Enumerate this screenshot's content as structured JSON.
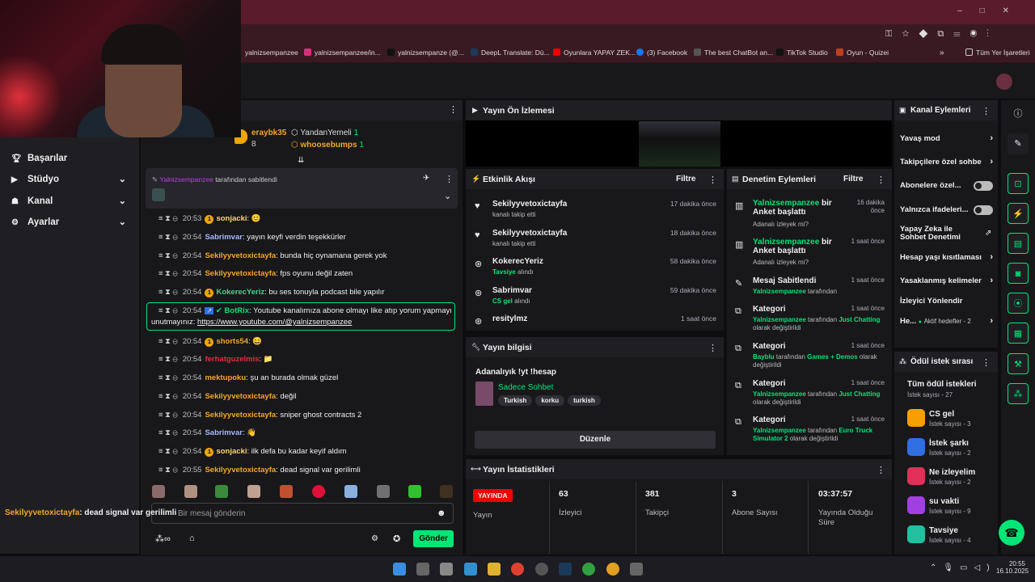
{
  "bookmarks": [
    "yalnizsempanzee",
    "yalnizsempanzee/in...",
    "yalnizsempanze (@...",
    "DeepL Translate: Dü...",
    "Oyunlara YAPAY ZEK...",
    "(3) Facebook",
    "The best ChatBot an...",
    "TikTok Studio",
    "Oyun - Quizei",
    "Tüm Yer İşaretleri"
  ],
  "nav": {
    "items": [
      "Başarılar",
      "Stüdyo",
      "Kanal",
      "Ayarlar"
    ]
  },
  "chat": {
    "top_users": [
      {
        "name": "eraybk35",
        "count": "8"
      },
      {
        "name": "YandanYemeli",
        "count": "1"
      },
      {
        "name": "whoosebumps",
        "count": "1"
      }
    ],
    "pinned_by": "Yalnizsempanzee",
    "pinned_suffix": "tarafından sabitlendi",
    "messages": [
      {
        "time": "20:53",
        "user": "sonjacki",
        "text": "😊",
        "color": "#ffd37a",
        "badge": "1"
      },
      {
        "time": "20:54",
        "user": "Sabrimvar",
        "text": "yayın keyfi verdin teşekkürler",
        "color": "#a6b8ff"
      },
      {
        "time": "20:54",
        "user": "Sekilyyvetoxictayfa",
        "text": "bunda hiç oynamana gerek yok",
        "color": "#f5a623"
      },
      {
        "time": "20:54",
        "user": "Sekilyyvetoxictayfa",
        "text": "fps oyunu değil zaten",
        "color": "#f5a623"
      },
      {
        "time": "20:54",
        "user": "KokerecYeriz",
        "text": "bu ses tonuyla podcast bile yapılır",
        "color": "#4ecf8c",
        "badge": "1"
      },
      {
        "time": "20:54",
        "user": "shorts54",
        "text": "😄",
        "color": "#f5a623",
        "badge": "1"
      },
      {
        "time": "20:54",
        "user": "ferhatguzelmis",
        "text": "📁",
        "color": "#e0303a"
      },
      {
        "time": "20:54",
        "user": "mektupoku",
        "text": "şu an burada olmak güzel",
        "color": "#f5a623"
      },
      {
        "time": "20:54",
        "user": "Sekilyyvetoxictayfa",
        "text": "değil",
        "color": "#f5a623"
      },
      {
        "time": "20:54",
        "user": "Sekilyyvetoxictayfa",
        "text": "sniper ghost contracts 2",
        "color": "#f5a623"
      },
      {
        "time": "20:54",
        "user": "Sabrimvar",
        "text": "👋",
        "color": "#a6b8ff"
      },
      {
        "time": "20:54",
        "user": "sonjacki",
        "text": "ilk defa bu kadar keyif aldım",
        "color": "#ffd37a",
        "badge": "1"
      },
      {
        "time": "20:55",
        "user": "Sekilyyvetoxictayfa",
        "text": "dead signal var gerilimli",
        "color": "#f5a623"
      }
    ],
    "bot": {
      "time": "20:54",
      "user": "BotRix",
      "text": "Youtube kanalımıza abone olmayı like atıp yorum yapmayı",
      "text2": "unutmayınız:",
      "link": "https://www.youtube.com/@yalnizsempanzee"
    },
    "input_placeholder": "Bir mesaj gönderin",
    "send_label": "Gönder",
    "overlay_user": "Sekilyyvetoxictayfa",
    "overlay_text": ": dead signal var gerilimli"
  },
  "preview": {
    "title": "Yayın Ön İzlemesi"
  },
  "activity": {
    "title": "Etkinlik Akışı",
    "filter": "Filtre",
    "items": [
      {
        "name": "Sekilyyvetoxictayfa",
        "sub": "kanalı takip etti",
        "time": "17 dakika önce",
        "icon": "♥"
      },
      {
        "name": "Sekilyyvetoxictayfa",
        "sub": "kanalı takip etti",
        "time": "18 dakika önce",
        "icon": "♥"
      },
      {
        "name": "KokerecYeriz",
        "sub_hl": "Tavsiye",
        "sub": "alındı",
        "time": "58 dakika önce",
        "icon": "⊛"
      },
      {
        "name": "Sabrimvar",
        "sub_hl": "CS gel",
        "sub": "alındı",
        "time": "59 dakika önce",
        "icon": "⊛"
      },
      {
        "name": "resitylmz",
        "sub_hl": "",
        "sub": "",
        "time": "1 saat önce",
        "icon": "⊛"
      }
    ]
  },
  "mod": {
    "title": "Denetim Eylemleri",
    "filter": "Filtre",
    "items": [
      {
        "title_g": "Yalnizsempanzee",
        "title": "bir Anket başlattı",
        "sub": "Adanalı izleyek mi?",
        "time": "16 dakika önce"
      },
      {
        "title_g": "Yalnizsempanzee",
        "title": "bir Anket başlattı",
        "sub": "Adanalı izleyek mi?",
        "time": "1 saat önce"
      },
      {
        "title": "Mesaj Sabitlendi",
        "sub_g": "Yalnizsempanzee",
        "sub": "tarafından",
        "time": "1 saat önce"
      },
      {
        "title": "Kategori",
        "sub_g": "Yalnizsempanzee",
        "sub": "tarafından",
        "sub_g2": "Just Chatting",
        "sub2": "olarak değiştirildi",
        "time": "1 saat önce"
      },
      {
        "title": "Kategori",
        "sub_g": "Bayblu",
        "sub": "tarafından",
        "sub_g2": "Games + Demos",
        "sub2": "olarak değiştirildi",
        "time": "1 saat önce"
      },
      {
        "title": "Kategori",
        "sub_g": "Yalnizsempanzee",
        "sub": "tarafından",
        "sub_g2": "Just Chatting",
        "sub2": "olarak değiştirildi",
        "time": "1 saat önce"
      },
      {
        "title": "Kategori",
        "sub_g": "Yalnizsempanzee",
        "sub": "tarafından",
        "sub_g2": "Euro Truck Simulator 2",
        "sub2": "olarak değiştirildi",
        "time": "1 saat önce"
      }
    ]
  },
  "info": {
    "title": "Yayın bilgisi",
    "stream_title": "Adanalıyık !yt !hesap",
    "category": "Sadece Sohbet",
    "tags": [
      "Turkish",
      "korku",
      "turkish"
    ],
    "edit": "Düzenle"
  },
  "stats": {
    "title": "Yayın İstatistikleri",
    "live": "YAYINDA",
    "live_label": "Yayın",
    "items": [
      {
        "value": "63",
        "label": "İzleyici"
      },
      {
        "value": "381",
        "label": "Takipçi"
      },
      {
        "value": "3",
        "label": "Abone Sayısı"
      },
      {
        "value": "03:37:57",
        "label": "Yayında Olduğu Süre"
      }
    ]
  },
  "channel": {
    "title": "Kanal Eylemleri",
    "items": [
      "Yavaş mod",
      "Takipçilere özel sohbe",
      "Abonelere özel...",
      "Yalnızca ifadeleri...",
      "Yapay Zeka ile Sohbet Denetimi",
      "Hesap yaşı kısıtlaması",
      "Yasaklanmış kelimeler",
      "İzleyici Yönlendir",
      "He..."
    ],
    "goal_label": "Aktif hedefler - 2"
  },
  "rewards": {
    "title": "Ödül istek sırası",
    "all": "Tüm ödül istekleri",
    "all_count": "İstek sayısı - 27",
    "items": [
      {
        "name": "CS gel",
        "count": "İstek sayısı - 3",
        "color": "#f5a000"
      },
      {
        "name": "İstek şarkı",
        "count": "İstek sayısı - 2",
        "color": "#2f6fe0"
      },
      {
        "name": "Ne izleyelim",
        "count": "İstek sayısı - 2",
        "color": "#e0305a"
      },
      {
        "name": "su vakti",
        "count": "İstek sayısı - 9",
        "color": "#a040e0"
      },
      {
        "name": "Tavsiye",
        "count": "İstek sayısı - 4",
        "color": "#20c0a0"
      }
    ]
  },
  "taskbar": {
    "time": "20:55",
    "date": "16.10.2025"
  },
  "colors": {
    "accent": "#00e676",
    "live": "#eb0400",
    "panel": "#18181b",
    "bg": "#0e0e10"
  }
}
